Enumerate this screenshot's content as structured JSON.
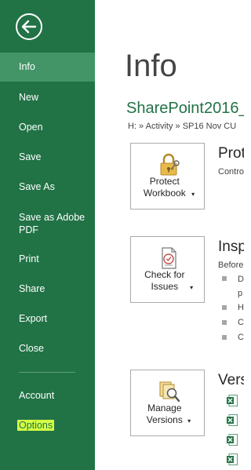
{
  "sidebar": {
    "back_icon": "back-arrow-icon",
    "items": [
      {
        "label": "Info"
      },
      {
        "label": "New"
      },
      {
        "label": "Open"
      },
      {
        "label": "Save"
      },
      {
        "label": "Save As"
      },
      {
        "label": "Save as Adobe PDF"
      },
      {
        "label": "Print"
      },
      {
        "label": "Share"
      },
      {
        "label": "Export"
      },
      {
        "label": "Close"
      },
      {
        "label": "Account"
      },
      {
        "label": "Options"
      }
    ]
  },
  "main": {
    "title": "Info",
    "document_title": "SharePoint2016_",
    "path": "H: » Activity » SP16 Nov CU",
    "sections": {
      "protect": {
        "button_label": "Protect Workbook",
        "title": "Prot",
        "text": "Contro"
      },
      "inspect": {
        "button_label": "Check for Issues",
        "title": "Insp",
        "text": "Before",
        "bullets": [
          "D",
          "p",
          "H",
          "C",
          "C"
        ]
      },
      "versions": {
        "button_label": "Manage Versions",
        "title": "Vers"
      }
    }
  },
  "colors": {
    "sidebar": "#217346",
    "active_item": "#439467",
    "options_highlight": "#d6ff44",
    "accent": "#217346"
  }
}
